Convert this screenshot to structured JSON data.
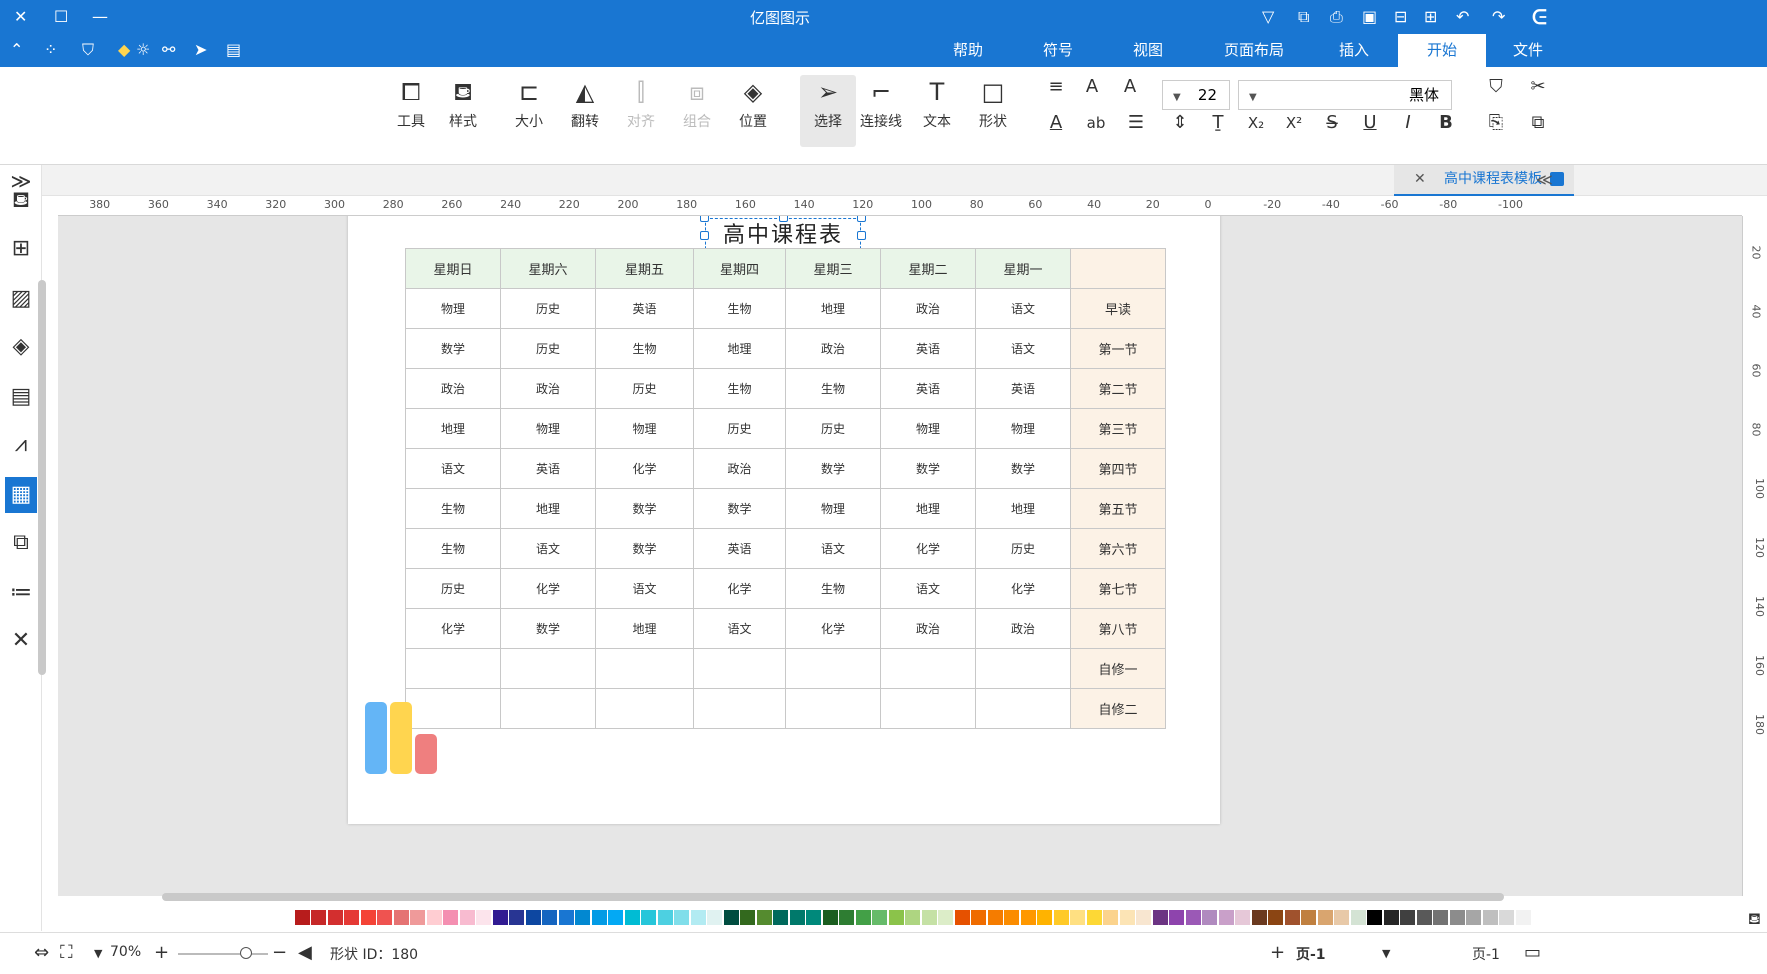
{
  "titlebar": {
    "title": "亿图图示"
  },
  "menubar": {
    "items": [
      "文件",
      "开始",
      "插入",
      "页面布局",
      "视图",
      "符号",
      "帮助"
    ],
    "active": "开始"
  },
  "ribbon": {
    "font_name": "黑体",
    "font_size": "22",
    "buttons": [
      "形状",
      "文本",
      "连接线",
      "选择",
      "位置",
      "组合",
      "对齐",
      "翻转",
      "大小",
      "样式",
      "工具"
    ]
  },
  "document_tab": {
    "label": "高中课程表模板"
  },
  "rulers": {
    "h_labels": [
      "-100",
      "-80",
      "-60",
      "-40",
      "-20",
      "0",
      "20",
      "40",
      "60",
      "80",
      "100",
      "120",
      "140",
      "160",
      "180",
      "200",
      "220",
      "240",
      "260",
      "280",
      "300",
      "320",
      "340",
      "360",
      "380"
    ],
    "v_labels": [
      "20",
      "40",
      "60",
      "80",
      "100",
      "120",
      "140",
      "160",
      "180"
    ]
  },
  "page": {
    "title": "高中课程表",
    "columns": [
      "",
      "星期一",
      "星期二",
      "星期三",
      "星期四",
      "星期五",
      "星期六",
      "星期日"
    ],
    "rows": [
      {
        "label": "早读",
        "cells": [
          "语文",
          "政治",
          "地理",
          "生物",
          "英语",
          "历史",
          "物理"
        ]
      },
      {
        "label": "第一节",
        "cells": [
          "语文",
          "英语",
          "政治",
          "地理",
          "生物",
          "历史",
          "数学"
        ]
      },
      {
        "label": "第二节",
        "cells": [
          "英语",
          "英语",
          "生物",
          "生物",
          "历史",
          "政治",
          "政治"
        ]
      },
      {
        "label": "第三节",
        "cells": [
          "物理",
          "物理",
          "历史",
          "历史",
          "物理",
          "物理",
          "地理"
        ]
      },
      {
        "label": "第四节",
        "cells": [
          "数学",
          "数学",
          "数学",
          "政治",
          "化学",
          "英语",
          "语文"
        ]
      },
      {
        "label": "第五节",
        "cells": [
          "地理",
          "地理",
          "物理",
          "数学",
          "数学",
          "地理",
          "生物"
        ]
      },
      {
        "label": "第六节",
        "cells": [
          "历史",
          "化学",
          "语文",
          "英语",
          "数学",
          "语文",
          "生物"
        ]
      },
      {
        "label": "第七节",
        "cells": [
          "化学",
          "语文",
          "生物",
          "化学",
          "语文",
          "化学",
          "历史"
        ]
      },
      {
        "label": "第八节",
        "cells": [
          "政治",
          "政治",
          "化学",
          "语文",
          "地理",
          "数学",
          "化学"
        ]
      },
      {
        "label": "自修一",
        "cells": [
          "",
          "",
          "",
          "",
          "",
          "",
          ""
        ]
      },
      {
        "label": "自修二",
        "cells": [
          "",
          "",
          "",
          "",
          "",
          "",
          ""
        ]
      }
    ]
  },
  "statusbar": {
    "page_label": "页-1",
    "page_tab": "页-1",
    "shape_id": "形状 ID：180",
    "zoom": "70%"
  },
  "colors": {
    "accent": "#1976d2",
    "header_fill": "#e9f5e8",
    "row_header_fill": "#fcf2e6"
  },
  "palette": [
    "#ffffff",
    "#f2f2f2",
    "#d9d9d9",
    "#bfbfbf",
    "#a6a6a6",
    "#8c8c8c",
    "#737373",
    "#595959",
    "#404040",
    "#262626",
    "#000000",
    "#d4e3d4",
    "#e8c9a8",
    "#d9a56f",
    "#c08040",
    "#a0522d",
    "#8b4513",
    "#6b3a1f",
    "#e6c8d8",
    "#c9a0c9",
    "#b08abf",
    "#9b59b6",
    "#8e44ad",
    "#6c3483",
    "#f8e6d0",
    "#fce4b5",
    "#fbd38d",
    "#fdd835",
    "#ffe082",
    "#ffca28",
    "#ffb300",
    "#ff9800",
    "#fb8c00",
    "#f57c00",
    "#ef6c00",
    "#e65100",
    "#dcedc8",
    "#c5e1a5",
    "#aed581",
    "#8bc34a",
    "#66bb6a",
    "#43a047",
    "#2e7d32",
    "#1b5e20",
    "#00897b",
    "#00796b",
    "#00695c",
    "#558b2f",
    "#33691e",
    "#004d40",
    "#e0f2f1",
    "#b2ebf2",
    "#80deea",
    "#4dd0e1",
    "#26c6da",
    "#00bcd4",
    "#03a9f4",
    "#039be5",
    "#0288d1",
    "#1976d2",
    "#1565c0",
    "#0d47a1",
    "#283593",
    "#311b92",
    "#fce4ec",
    "#f8bbd0",
    "#f48fb1",
    "#ffcdd2",
    "#ef9a9a",
    "#e57373",
    "#ef5350",
    "#f44336",
    "#e53935",
    "#d32f2f",
    "#c62828",
    "#b71c1c"
  ]
}
